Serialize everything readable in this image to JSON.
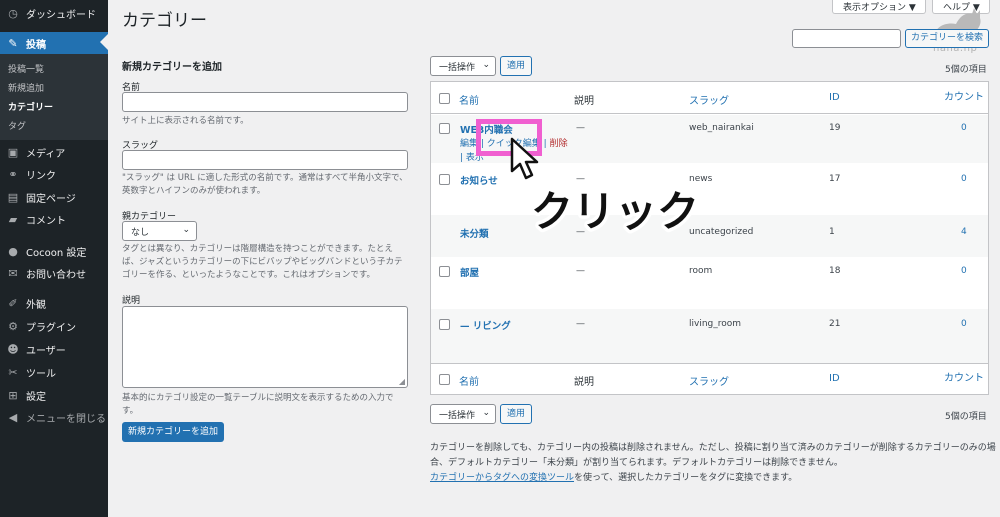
{
  "sidebar": {
    "items": [
      {
        "label": "ダッシュボード",
        "icon": "dashboard-icon"
      },
      {
        "label": "投稿",
        "icon": "pin-icon"
      },
      {
        "label": "メディア",
        "icon": "media-icon"
      },
      {
        "label": "リンク",
        "icon": "link-icon"
      },
      {
        "label": "固定ページ",
        "icon": "page-icon"
      },
      {
        "label": "コメント",
        "icon": "comment-icon"
      },
      {
        "label": "Cocoon 設定",
        "icon": "cocoon-icon"
      },
      {
        "label": "お問い合わせ",
        "icon": "mail-icon"
      },
      {
        "label": "外観",
        "icon": "brush-icon"
      },
      {
        "label": "プラグイン",
        "icon": "plugin-icon"
      },
      {
        "label": "ユーザー",
        "icon": "user-icon"
      },
      {
        "label": "ツール",
        "icon": "wrench-icon"
      },
      {
        "label": "設定",
        "icon": "settings-icon"
      },
      {
        "label": "メニューを閉じる",
        "icon": "collapse-icon"
      }
    ],
    "submenu": [
      "投稿一覧",
      "新規追加",
      "カテゴリー",
      "タグ"
    ]
  },
  "header": {
    "title": "カテゴリー",
    "screen_options": "表示オプション ▼",
    "help": "ヘルプ ▼",
    "search_button": "カテゴリーを検索",
    "logo_text": "nana.hp"
  },
  "form": {
    "heading": "新規カテゴリーを追加",
    "name_label": "名前",
    "name_desc": "サイト上に表示される名前です。",
    "slug_label": "スラッグ",
    "slug_desc": "\"スラッグ\" は URL に適した形式の名前です。通常はすべて半角小文字で、英数字とハイフンのみが使われます。",
    "parent_label": "親カテゴリー",
    "parent_value": "なし",
    "parent_desc": "タグとは異なり、カテゴリーは階層構造を持つことができます。たとえば、ジャズというカテゴリーの下にビバップやビッグバンドという子カテゴリーを作る、といったようなことです。これはオプションです。",
    "desc_label": "説明",
    "desc_desc": "基本的にカテゴリ設定の一覧テーブルに説明文を表示するための入力です。",
    "submit": "新規カテゴリーを追加"
  },
  "table": {
    "bulk_action": "一括操作",
    "apply": "適用",
    "item_count": "5個の項目",
    "columns": [
      "名前",
      "説明",
      "スラッグ",
      "ID",
      "カウント"
    ],
    "rows": [
      {
        "name": "WEB内職会",
        "desc": "—",
        "slug": "web_nairankai",
        "id": "19",
        "count": "0"
      },
      {
        "name": "お知らせ",
        "desc": "—",
        "slug": "news",
        "id": "17",
        "count": "0"
      },
      {
        "name": "未分類",
        "desc": "—",
        "slug": "uncategorized",
        "id": "1",
        "count": "4"
      },
      {
        "name": "部屋",
        "desc": "—",
        "slug": "room",
        "id": "18",
        "count": "0"
      },
      {
        "name": "— リビング",
        "desc": "—",
        "slug": "living_room",
        "id": "21",
        "count": "0"
      }
    ],
    "row_actions": {
      "edit": "編集",
      "quick_edit": "クイック編集",
      "delete": "削除",
      "view": "表示"
    }
  },
  "note": {
    "line1": "カテゴリーを削除しても、カテゴリー内の投稿は削除されません。ただし、投稿に割り当て済みのカテゴリーが削除するカテゴリーのみの場",
    "line2": "合、デフォルトカテゴリー「未分類」が割り当てられます。デフォルトカテゴリーは削除できません。",
    "link": "カテゴリーからタグへの変換ツール",
    "line3_rest": "を使って、選択したカテゴリーをタグに変換できます。"
  },
  "annotation": {
    "click_label": "クリック",
    "highlight_color": "#f05fd0"
  }
}
